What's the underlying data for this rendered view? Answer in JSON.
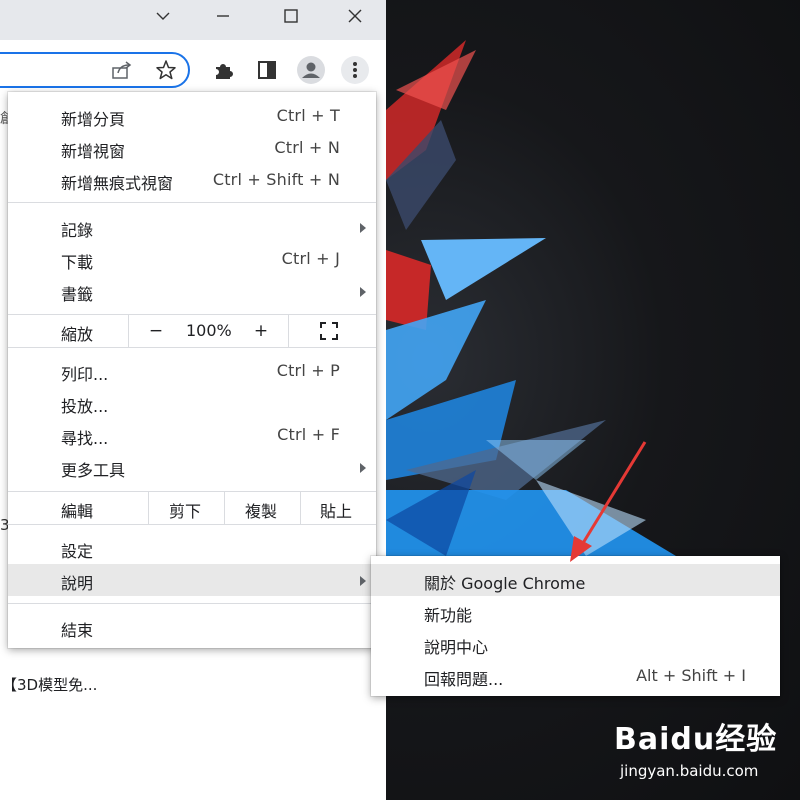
{
  "window": {
    "controls": [
      "chevron-down",
      "minimize",
      "maximize",
      "close"
    ]
  },
  "toolbar": {
    "icons": [
      "share-icon",
      "star-icon",
      "extensions-icon",
      "side-panel-icon",
      "profile-icon",
      "more-menu-icon"
    ]
  },
  "page": {
    "bookmark_fragment": "創",
    "text_fragment": "3",
    "link_text": "【3D模型免..."
  },
  "menu": {
    "items": [
      {
        "label": "新增分頁",
        "shortcut": "Ctrl + T"
      },
      {
        "label": "新增視窗",
        "shortcut": "Ctrl + N"
      },
      {
        "label": "新增無痕式視窗",
        "shortcut": "Ctrl + Shift + N"
      },
      {
        "label": "記錄",
        "has_submenu": true
      },
      {
        "label": "下載",
        "shortcut": "Ctrl + J"
      },
      {
        "label": "書籤",
        "has_submenu": true
      },
      {
        "label": "列印...",
        "shortcut": "Ctrl + P"
      },
      {
        "label": "投放..."
      },
      {
        "label": "尋找...",
        "shortcut": "Ctrl + F"
      },
      {
        "label": "更多工具",
        "has_submenu": true
      },
      {
        "label": "設定"
      },
      {
        "label": "說明",
        "has_submenu": true,
        "highlighted": true
      },
      {
        "label": "結束"
      }
    ],
    "zoom": {
      "label": "縮放",
      "minus": "−",
      "value": "100%",
      "plus": "+"
    },
    "edit": {
      "label": "編輯",
      "cut": "剪下",
      "copy": "複製",
      "paste": "貼上"
    }
  },
  "submenu": {
    "items": [
      {
        "label": "關於 Google Chrome",
        "highlighted": true
      },
      {
        "label": "新功能"
      },
      {
        "label": "說明中心"
      },
      {
        "label": "回報問題...",
        "shortcut": "Alt + Shift + I"
      }
    ]
  },
  "watermark": {
    "logo": "Baidu经验",
    "url": "jingyan.baidu.com"
  },
  "colors": {
    "accent": "#1a73e8",
    "highlight": "#e8e8e8",
    "annotation": "#e53935"
  }
}
